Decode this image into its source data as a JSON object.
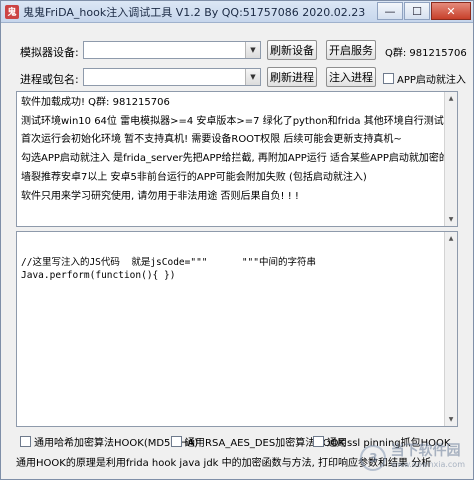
{
  "window": {
    "title": "鬼鬼FriDA_hook注入调试工具 V1.2 By QQ:51757086 2020.02.23",
    "app_icon": "鬼",
    "min_glyph": "—",
    "max_glyph": "☐",
    "close_glyph": "✕"
  },
  "row1": {
    "simulator_label": "模拟器设备:",
    "simulator_value": "",
    "refresh_devices_label": "刷新设备",
    "start_service_label": "开启服务",
    "qq_group_label": "Q群: 981215706"
  },
  "row2": {
    "process_label": "进程或包名:",
    "process_value": "",
    "refresh_process_label": "刷新进程",
    "inject_label": "注入进程",
    "app_autostart_label": "APP启动就注入"
  },
  "log": {
    "lines": [
      "软件加载成功! Q群: 981215706",
      "测试环境win10 64位 雷电模拟器>=4 安卓版本>=7 绿化了python和frida 其他环境自行测试",
      "首次运行会初始化环境 暂不支持真机! 需要设备ROOT权限 后续可能会更新支持真机~",
      "勾选APP启动就注入 是frida_server先把APP给拦截, 再附加APP运行 适合某些APP启动就加密的情况",
      "墙裂推荐安卓7以上 安卓5非前台运行的APP可能会附加失败 (包括启动就注入)",
      "软件只用来学习研究使用, 请勿用于非法用途 否则后果自负! ! !"
    ]
  },
  "code": {
    "lines": [
      "//这里写注入的JS代码  就是jsCode=\"\"\"      \"\"\"中间的字符串",
      "Java.perform(function(){ })"
    ]
  },
  "options": {
    "opt1": "通用哈希加密算法HOOK(MD5 SHA)",
    "opt2": "通用RSA_AES_DES加密算法HOOK",
    "opt3": "通用ssl pinning抓包HOOK"
  },
  "footer": {
    "text": "通用HOOK的原理是利用frida hook java jdk 中的加密函数与方法, 打印响应参数和结果 分析"
  },
  "watermark": {
    "badge": "3",
    "cn": "当下软件园",
    "url": "www.downxia.com"
  },
  "colors": {
    "window_bg": "#f0f0f0",
    "titlebar": "#c7d6ec",
    "close_button": "#c7402a"
  }
}
